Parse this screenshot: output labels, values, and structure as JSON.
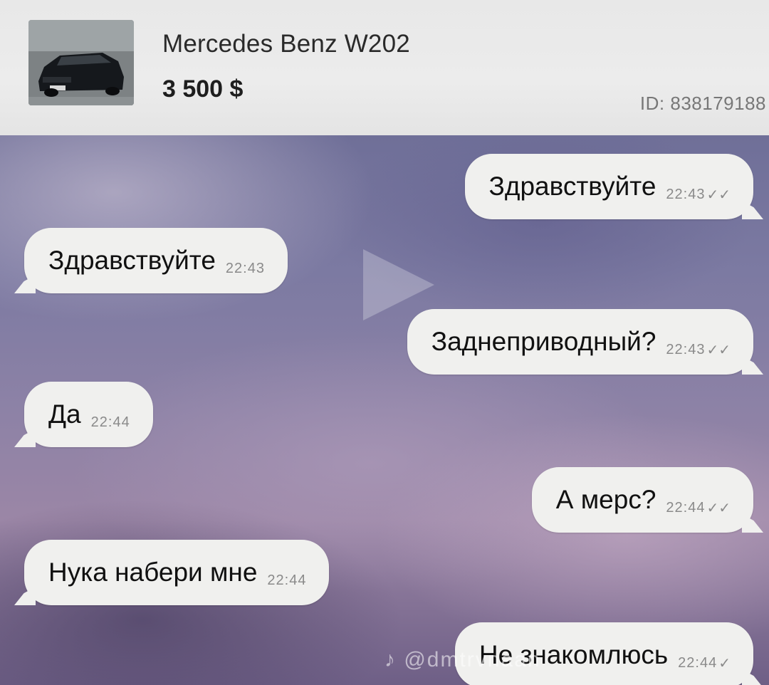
{
  "listing": {
    "title": "Mercedes Benz W202",
    "price": "3 500 $",
    "id": "ID: 838179188",
    "thumbnail_icon": "car-photo"
  },
  "messages": [
    {
      "side": "out",
      "text": "Здравствуйте",
      "time": "22:43",
      "status": "read"
    },
    {
      "side": "in",
      "text": "Здравствуйте",
      "time": "22:43"
    },
    {
      "side": "out",
      "text": "Заднеприводный?",
      "time": "22:43",
      "status": "read"
    },
    {
      "side": "in",
      "text": "Да",
      "time": "22:44"
    },
    {
      "side": "out",
      "text": "А мерс?",
      "time": "22:44",
      "status": "read"
    },
    {
      "side": "in",
      "text": "Нука набери мне",
      "time": "22:44"
    },
    {
      "side": "out",
      "text": "Не знакомлюсь",
      "time": "22:44",
      "status": "sent"
    }
  ],
  "watermark": "@dmtrvnaan",
  "icons": {
    "read": "✓✓",
    "sent": "✓"
  },
  "colors": {
    "bubble": "#f0f0ee",
    "header_bg": "#e8e8e8",
    "chat_bg": "#7c7aa2"
  }
}
